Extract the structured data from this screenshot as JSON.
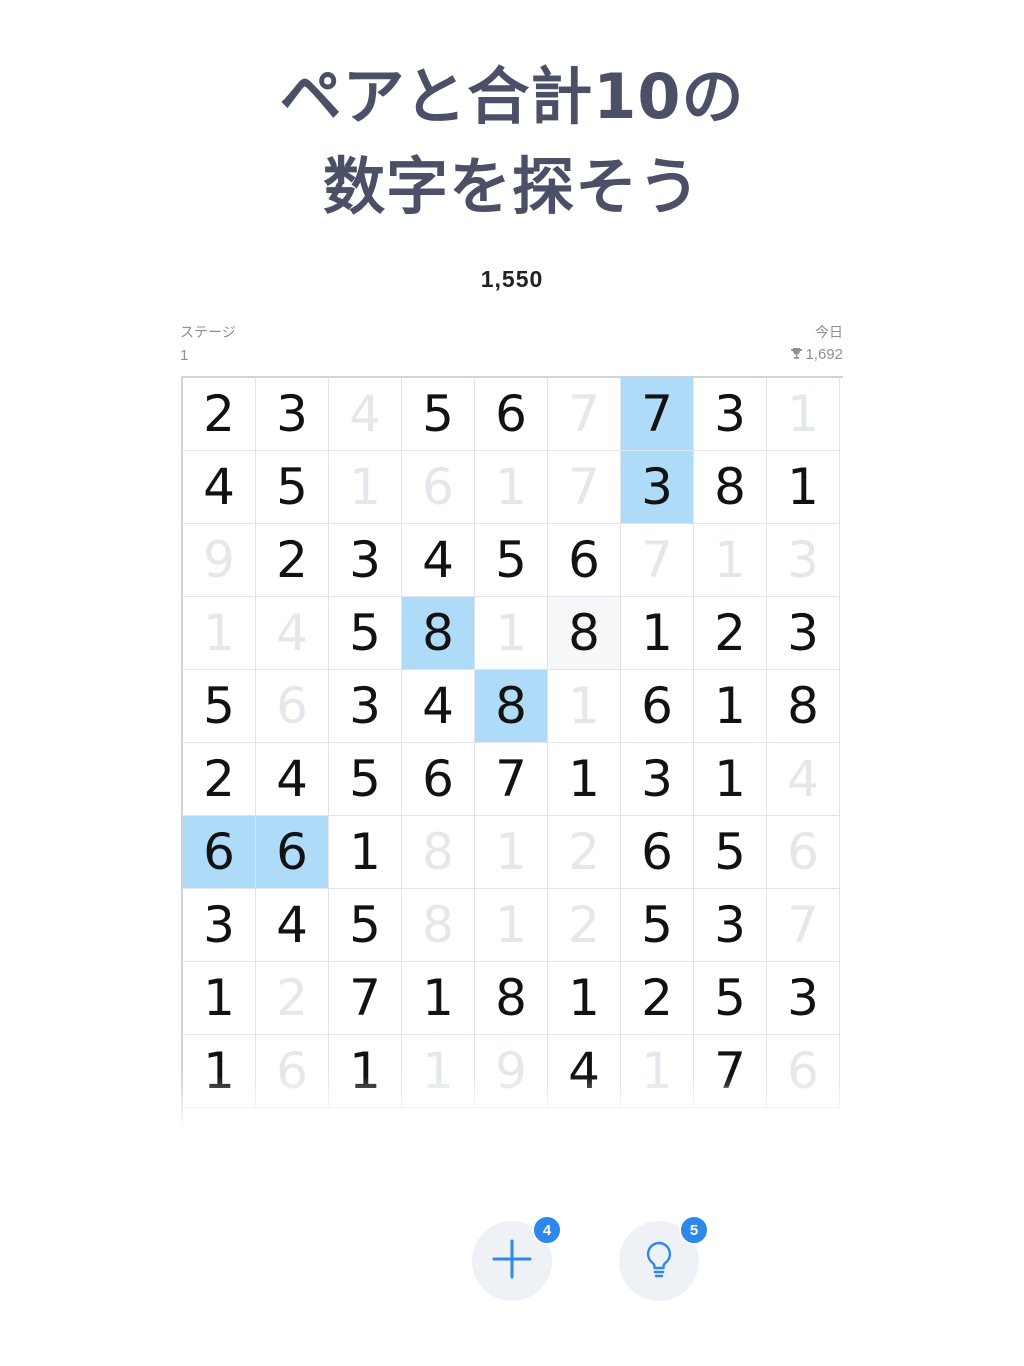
{
  "headline": {
    "line1": "ペアと合計10の",
    "line2": "数字を探そう"
  },
  "score": "1,550",
  "stage": {
    "label": "ステージ",
    "value": "1"
  },
  "today": {
    "label": "今日",
    "best": "1,692",
    "icon": "trophy-icon"
  },
  "board": {
    "columns": 9,
    "rows": [
      [
        {
          "v": "2"
        },
        {
          "v": "3"
        },
        {
          "v": "4",
          "s": "faded"
        },
        {
          "v": "5"
        },
        {
          "v": "6"
        },
        {
          "v": "7",
          "s": "faded"
        },
        {
          "v": "7",
          "s": "selected"
        },
        {
          "v": "3"
        },
        {
          "v": "1",
          "s": "faded"
        }
      ],
      [
        {
          "v": "4"
        },
        {
          "v": "5"
        },
        {
          "v": "1",
          "s": "faded"
        },
        {
          "v": "6",
          "s": "faded"
        },
        {
          "v": "1",
          "s": "faded"
        },
        {
          "v": "7",
          "s": "faded"
        },
        {
          "v": "3",
          "s": "selected"
        },
        {
          "v": "8"
        },
        {
          "v": "1"
        }
      ],
      [
        {
          "v": "9",
          "s": "faded"
        },
        {
          "v": "2"
        },
        {
          "v": "3"
        },
        {
          "v": "4"
        },
        {
          "v": "5"
        },
        {
          "v": "6"
        },
        {
          "v": "7",
          "s": "faded"
        },
        {
          "v": "1",
          "s": "faded"
        },
        {
          "v": "3",
          "s": "faded"
        }
      ],
      [
        {
          "v": "1",
          "s": "faded"
        },
        {
          "v": "4",
          "s": "faded"
        },
        {
          "v": "5"
        },
        {
          "v": "8",
          "s": "selected"
        },
        {
          "v": "1",
          "s": "faded"
        },
        {
          "v": "8",
          "s": "soft"
        },
        {
          "v": "1"
        },
        {
          "v": "2"
        },
        {
          "v": "3"
        }
      ],
      [
        {
          "v": "5"
        },
        {
          "v": "6",
          "s": "faded"
        },
        {
          "v": "3"
        },
        {
          "v": "4"
        },
        {
          "v": "8",
          "s": "selected"
        },
        {
          "v": "1",
          "s": "faded"
        },
        {
          "v": "6"
        },
        {
          "v": "1"
        },
        {
          "v": "8"
        }
      ],
      [
        {
          "v": "2"
        },
        {
          "v": "4"
        },
        {
          "v": "5"
        },
        {
          "v": "6"
        },
        {
          "v": "7"
        },
        {
          "v": "1"
        },
        {
          "v": "3"
        },
        {
          "v": "1"
        },
        {
          "v": "4",
          "s": "faded"
        }
      ],
      [
        {
          "v": "6",
          "s": "selected"
        },
        {
          "v": "6",
          "s": "selected"
        },
        {
          "v": "1"
        },
        {
          "v": "8",
          "s": "faded"
        },
        {
          "v": "1",
          "s": "faded"
        },
        {
          "v": "2",
          "s": "faded"
        },
        {
          "v": "6"
        },
        {
          "v": "5"
        },
        {
          "v": "6",
          "s": "faded"
        }
      ],
      [
        {
          "v": "3"
        },
        {
          "v": "4"
        },
        {
          "v": "5"
        },
        {
          "v": "8",
          "s": "faded"
        },
        {
          "v": "1",
          "s": "faded"
        },
        {
          "v": "2",
          "s": "faded"
        },
        {
          "v": "5"
        },
        {
          "v": "3"
        },
        {
          "v": "7",
          "s": "faded"
        }
      ],
      [
        {
          "v": "1"
        },
        {
          "v": "2",
          "s": "faded"
        },
        {
          "v": "7"
        },
        {
          "v": "1"
        },
        {
          "v": "8"
        },
        {
          "v": "1"
        },
        {
          "v": "2"
        },
        {
          "v": "5"
        },
        {
          "v": "3"
        }
      ],
      [
        {
          "v": "1"
        },
        {
          "v": "6",
          "s": "faded"
        },
        {
          "v": "1"
        },
        {
          "v": "1",
          "s": "faded"
        },
        {
          "v": "9",
          "s": "faded"
        },
        {
          "v": "4"
        },
        {
          "v": "1",
          "s": "faded"
        },
        {
          "v": "7"
        },
        {
          "v": "6",
          "s": "faded"
        }
      ]
    ]
  },
  "actions": {
    "add": {
      "icon": "plus-icon",
      "badge": "4",
      "color": "#2d88ea"
    },
    "hint": {
      "icon": "lightbulb-icon",
      "badge": "5",
      "color": "#2d88ea"
    }
  }
}
